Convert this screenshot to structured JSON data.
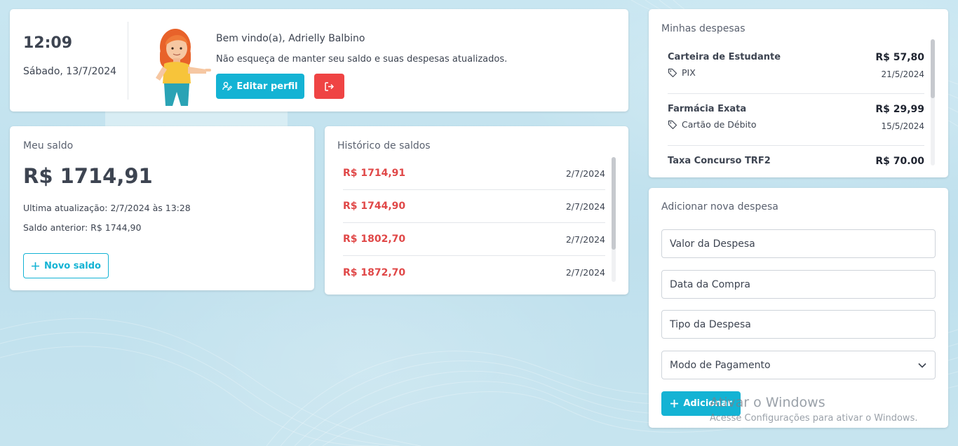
{
  "welcome": {
    "time": "12:09",
    "date": "Sábado, 13/7/2024",
    "greeting": "Bem vindo(a), Adrielly Balbino",
    "reminder": "Não esqueça de manter seu saldo e suas despesas atualizados.",
    "edit_profile_label": "Editar perfil",
    "edit_icon": "user-edit-icon",
    "logout_icon": "logout-icon"
  },
  "saldo": {
    "title": "Meu saldo",
    "value": "R$ 1714,91",
    "updated": "Ultima atualização: 2/7/2024 às 13:28",
    "previous": "Saldo anterior: R$ 1744,90",
    "new_label": "Novo saldo"
  },
  "historico": {
    "title": "Histórico de saldos",
    "items": [
      {
        "value": "R$ 1714,91",
        "date": "2/7/2024"
      },
      {
        "value": "R$ 1744,90",
        "date": "2/7/2024"
      },
      {
        "value": "R$ 1802,70",
        "date": "2/7/2024"
      },
      {
        "value": "R$ 1872,70",
        "date": "2/7/2024"
      }
    ]
  },
  "despesas": {
    "title": "Minhas despesas",
    "items": [
      {
        "name": "Carteira de Estudante",
        "tag": "PIX",
        "amount": "R$ 57,80",
        "date": "21/5/2024"
      },
      {
        "name": "Farmácia Exata",
        "tag": "Cartão de Débito",
        "amount": "R$ 29,99",
        "date": "15/5/2024"
      },
      {
        "name": "Taxa Concurso TRF2",
        "tag": "",
        "amount": "R$ 70.00",
        "date": ""
      }
    ]
  },
  "form": {
    "title": "Adicionar nova despesa",
    "valor_placeholder": "Valor da Despesa",
    "data_placeholder": "Data da Compra",
    "tipo_placeholder": "Tipo da Despesa",
    "modo_label": "Modo de Pagamento",
    "add_label": "Adicionar"
  },
  "watermark": {
    "title": "Ativar o Windows",
    "subtitle": "Acesse Configurações para ativar o Windows."
  },
  "colors": {
    "accent": "#14b3d4",
    "danger": "#ef4444",
    "history_value": "#e04848",
    "background": "#c2e2ee"
  }
}
